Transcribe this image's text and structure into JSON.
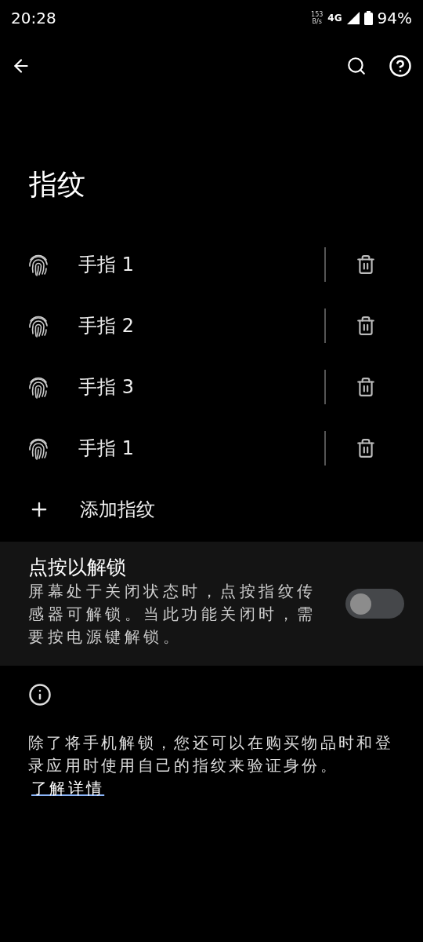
{
  "status_bar": {
    "time": "20:28",
    "net_speed": "153",
    "net_unit": "B/s",
    "network": "4G",
    "battery": "94%"
  },
  "title": "指纹",
  "fingerprints": [
    {
      "name": "手指 1"
    },
    {
      "name": "手指 2"
    },
    {
      "name": "手指 3"
    },
    {
      "name": "手指 1"
    }
  ],
  "add_label": "添加指纹",
  "tap_unlock": {
    "title": "点按以解锁",
    "description": "屏幕处于关闭状态时，点按指纹传感器可解锁。当此功能关闭时，需要按电源键解锁。",
    "on": false
  },
  "info": {
    "text": "除了将手机解锁，您还可以在购买物品时和登录应用时使用自己的指纹来验证身份。",
    "link": "了解详情"
  }
}
